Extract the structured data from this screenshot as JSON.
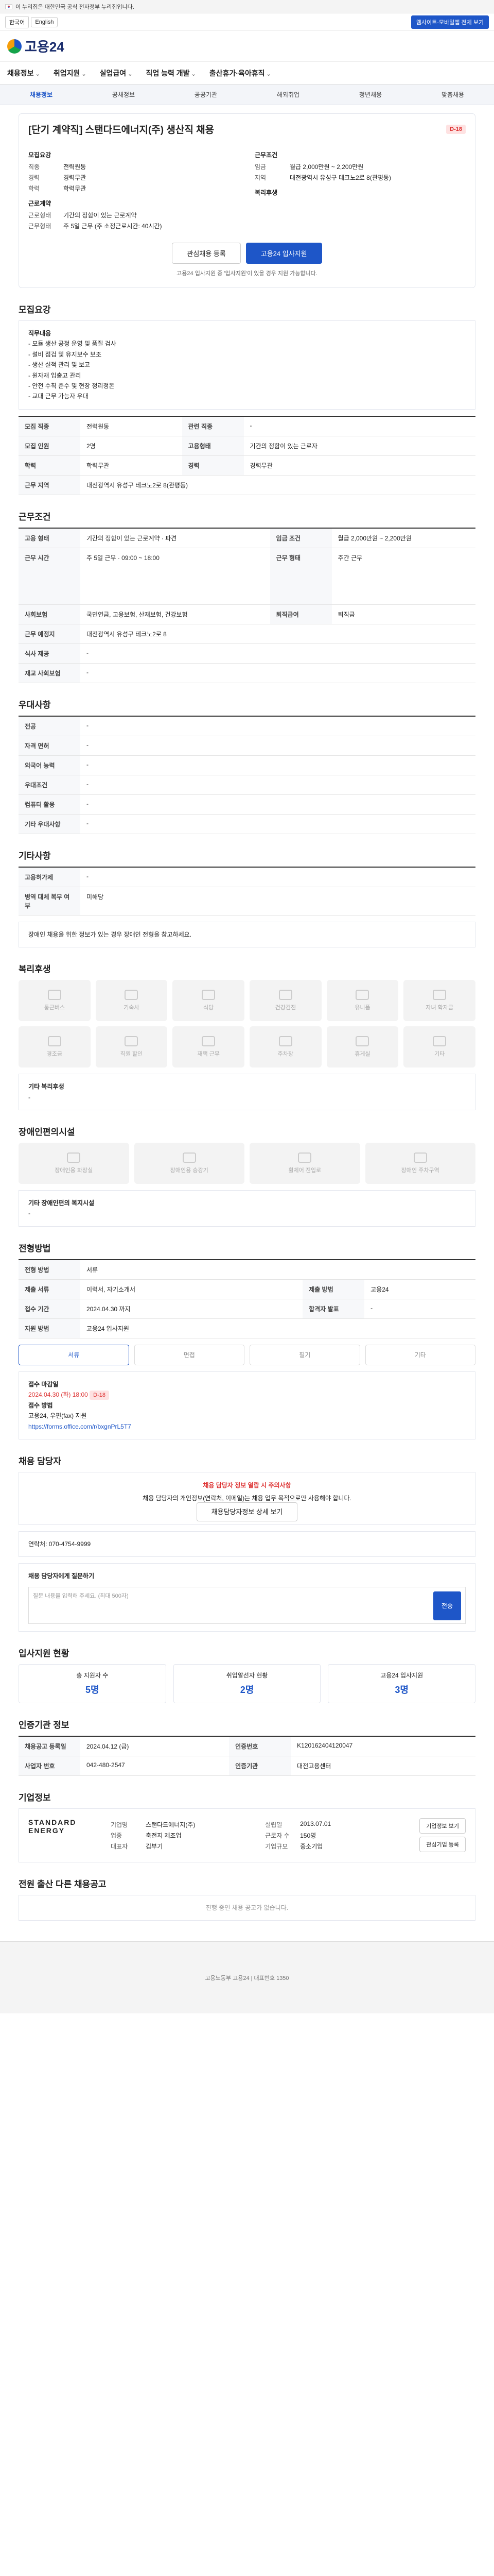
{
  "gov_bar": {
    "text": "이 누리집은 대한민국 공식 전자정부 누리집입니다."
  },
  "lang": {
    "items": [
      "한국어",
      "English"
    ],
    "right_link": "웹사이트·모바일앱 전체 보기"
  },
  "logo": {
    "text": "고용24"
  },
  "gnb": {
    "items": [
      "채용정보",
      "취업지원",
      "실업급여",
      "직업 능력 개발",
      "출산휴가·육아휴직"
    ]
  },
  "subnav": {
    "items": [
      "채용정보",
      "공채정보",
      "공공기관",
      "해외취업",
      "청년채용",
      "맞춤채용"
    ]
  },
  "job": {
    "title": "[단기 계약직] 스탠다드에너지(주) 생산직 채용",
    "dday": "D-18",
    "left_heading": "모집요강",
    "right_heading": "근무조건",
    "rows_left": [
      [
        "직종",
        "전력원동"
      ],
      [
        "경력",
        "경력무관"
      ],
      [
        "학력",
        "학력무관"
      ]
    ],
    "rows_right": [
      [
        "임금",
        "월급 2,000만원 ~ 2,200만원"
      ],
      [
        "지역",
        "대전광역시 유성구 테크노2로 8(관평동)"
      ]
    ],
    "left_heading2": "근로계약",
    "rows_left2": [
      [
        "근로형태",
        "기간의 정함이 있는 근로계약"
      ],
      [
        "근무형태",
        "주 5일 근무 (주 소정근로시간: 40시간)"
      ]
    ],
    "right_heading2": "복리후생",
    "btn_interest": "관심채용 등록",
    "btn_apply": "고용24 입사지원",
    "note": "고용24 입사지원 중 '입사지원'이 있을 경우 지원 가능합니다."
  },
  "sections": {
    "recruit": "모집요강",
    "work": "근무조건",
    "welfare": "우대사항",
    "etc": "기타사항",
    "benefits": "복리후생",
    "facility": "장애인편의시설",
    "apply": "전형방법",
    "manager": "채용 담당자",
    "applicants": "입사지원 현황",
    "info": "인증기관 정보",
    "company": "기업정보",
    "others": "전원 출산 다른 채용공고"
  },
  "recruit_box": {
    "title": "직무내용",
    "lines": [
      "- 모듈 생산 공정 운영 및 품질 검사",
      "- 설비 점검 및 유지보수 보조",
      "- 생산 실적 관리 및 보고",
      "- 원자재 입출고 관리",
      "- 안전 수칙 준수 및 현장 정리정돈",
      "- 교대 근무 가능자 우대"
    ]
  },
  "recruit_table": [
    [
      "모집 직종",
      "전력원동",
      "관련 직종",
      "-"
    ],
    [
      "모집 인원",
      "2명",
      "고용형태",
      "기간의 정함이 있는 근로자"
    ],
    [
      "학력",
      "학력무관",
      "경력",
      "경력무관"
    ],
    [
      "근무 지역",
      "대전광역시 유성구 테크노2로 8(관평동)",
      "",
      ""
    ]
  ],
  "work_table": [
    [
      "고용 형태",
      "기간의 정함이 있는 근로계약 · 파견",
      "임금 조건",
      "월급 2,000만원 ~ 2,200만원"
    ],
    [
      "근무 시간",
      "주 5일 근무 · 09:00 ~ 18:00",
      "근무 형태",
      "주간 근무"
    ],
    [
      "사회보험",
      "국민연금, 고용보험, 산재보험, 건강보험",
      "퇴직급여",
      "퇴직금"
    ],
    [
      "근무 예정지",
      "대전광역시 유성구 테크노2로 8",
      "",
      ""
    ],
    [
      "식사 제공",
      "-",
      "",
      ""
    ],
    [
      "재교 사회보험",
      "-",
      "",
      ""
    ]
  ],
  "welfare_table": [
    [
      "전공",
      "-"
    ],
    [
      "자격 면허",
      "-"
    ],
    [
      "외국어 능력",
      "-"
    ],
    [
      "우대조건",
      "-"
    ],
    [
      "컴퓨터 활용",
      "-"
    ],
    [
      "기타 우대사항",
      "-"
    ]
  ],
  "etc_table": [
    [
      "고용허가제",
      "-"
    ],
    [
      "병역 대체 복무 여부",
      "미해당"
    ]
  ],
  "etc_notice": "장애인 채용을 위한 정보가 있는 경우 장애인 전형을 참고하세요.",
  "benefits_icons": [
    "통근버스",
    "기숙사",
    "식당",
    "건강검진",
    "유니폼",
    "자녀 학자금",
    "경조금",
    "직원 할인",
    "재택 근무",
    "주차장",
    "휴게실",
    "기타"
  ],
  "benefits_etc": {
    "label": "기타 복리후생",
    "value": "-"
  },
  "facility_icons": [
    "장애인용 화장실",
    "장애인용 승강기",
    "휠체어 진입로",
    "장애인 주차구역"
  ],
  "facility_etc": {
    "label": "기타 장애인편의 복지시설",
    "value": "-"
  },
  "apply_table": [
    [
      "전형 방법",
      "서류",
      "",
      ""
    ],
    [
      "제출 서류",
      "이력서, 자기소개서",
      "제출 방법",
      "고용24"
    ],
    [
      "접수 기간",
      "2024.04.30 까지",
      "합격자 발표",
      "-"
    ],
    [
      "지원 방법",
      "고용24 입사지원",
      "",
      ""
    ]
  ],
  "apply_methods": [
    "서류",
    "면접",
    "필기",
    "기타"
  ],
  "apply_deadline": {
    "label": "접수 마감일",
    "value": "2024.04.30 (화) 18:00",
    "dday": "D-18"
  },
  "apply_docs": {
    "label": "접수 방법",
    "value": "고용24, 우편(fax) 지원",
    "link": "https://forms.office.com/r/bxgnPrL5T7"
  },
  "manager": {
    "alert_title": "채용 담당자 정보 열람 시 주의사항",
    "alert_body": "채용 담당자의 개인정보(연락처, 이메일)는 채용 업무 목적으로만 사용해야 합니다.",
    "btn": "채용담당자정보 상세 보기",
    "contact": "연락처: 070-4754-9999"
  },
  "inquiry": {
    "label": "채용 담당자에게 질문하기",
    "placeholder": "질문 내용을 입력해 주세요. (최대 500자)",
    "send": "전송"
  },
  "applicants": [
    [
      "총 지원자 수",
      "5명"
    ],
    [
      "취업알선자 현황",
      "2명"
    ],
    [
      "고용24 입사지원",
      "3명"
    ]
  ],
  "cert_table": [
    [
      "채용공고 등록일",
      "2024.04.12 (금)",
      "인증번호",
      "K120162404120047"
    ],
    [
      "사업자 번호",
      "042-480-2547",
      "인증기관",
      "대전고용센터"
    ]
  ],
  "company": {
    "logo": "STANDARD ENERGY",
    "rows": [
      [
        "기업명",
        "스탠다드에너지(주)"
      ],
      [
        "업종",
        "축전지 제조업"
      ],
      [
        "대표자",
        "김부기"
      ],
      [
        "설립일",
        "2013.07.01"
      ],
      [
        "근로자 수",
        "150명"
      ],
      [
        "기업규모",
        "중소기업"
      ]
    ],
    "btn_info": "기업정보 보기",
    "btn_follow": "관심기업 등록"
  },
  "others_empty": "진행 중인 채용 공고가 없습니다.",
  "footer": "고용노동부 고용24 | 대표번호 1350"
}
